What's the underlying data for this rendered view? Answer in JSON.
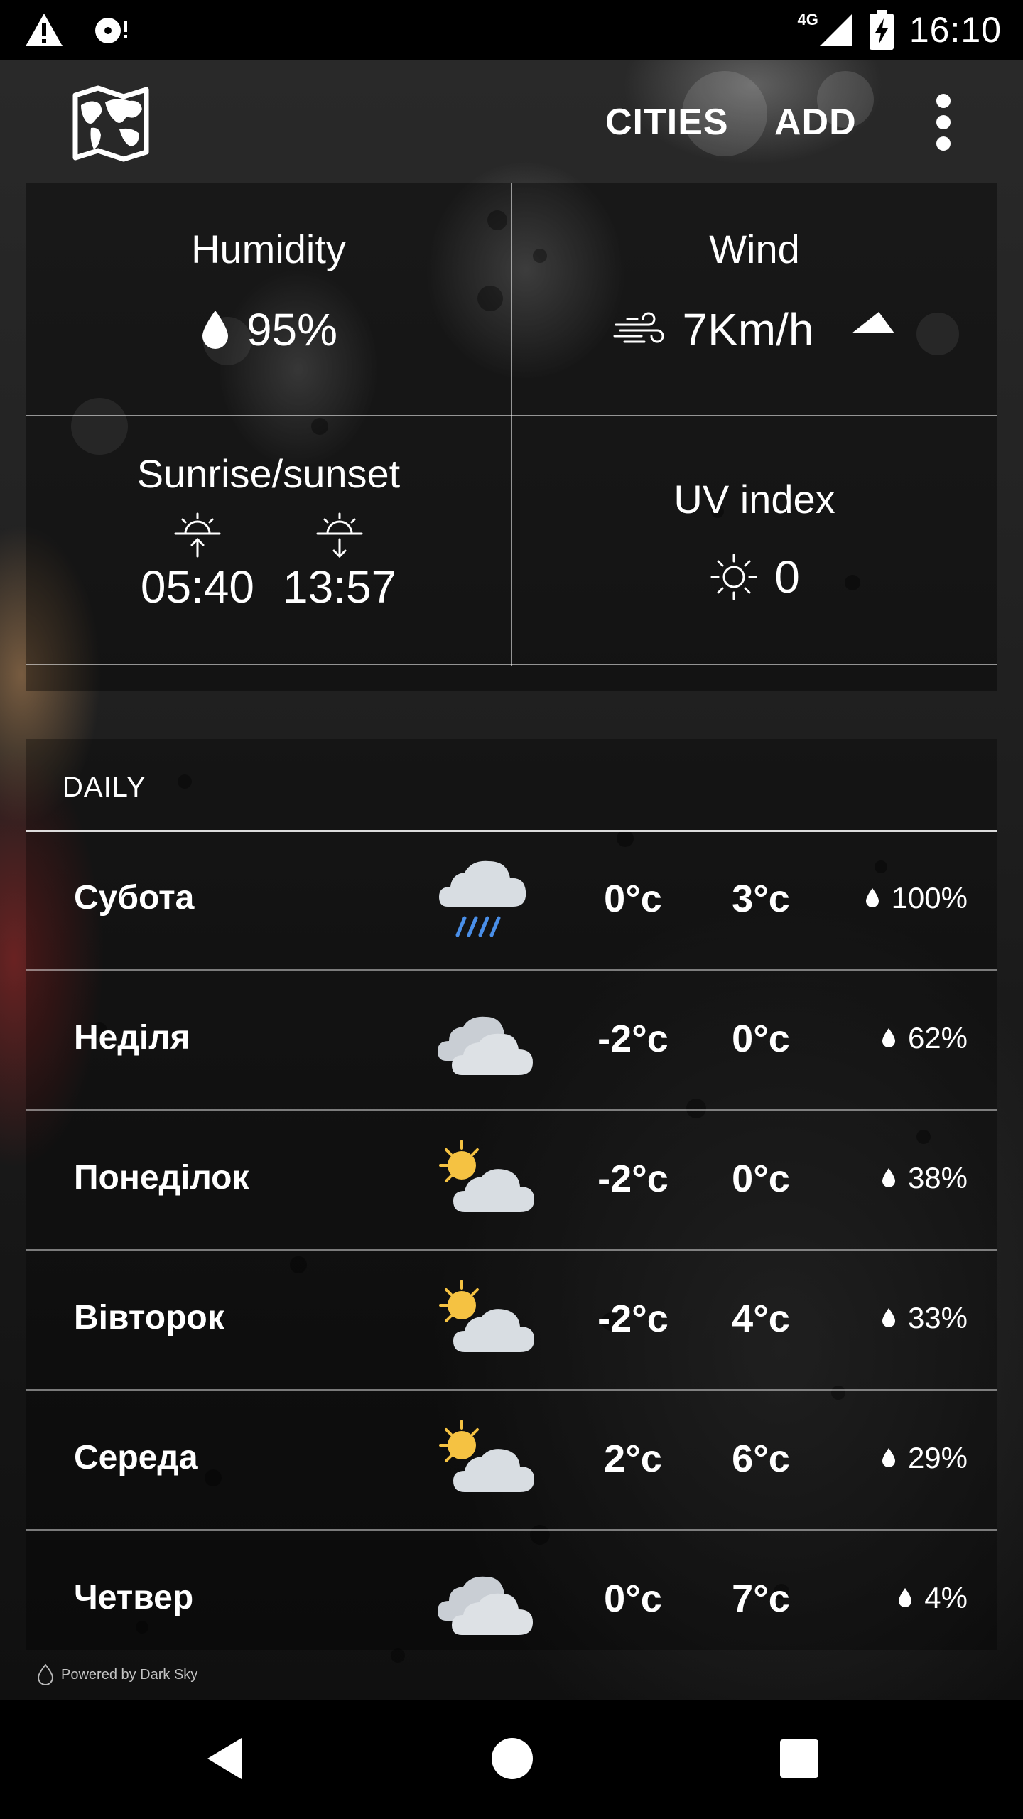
{
  "status_bar": {
    "time": "16:10",
    "network": "4G",
    "icons": [
      "warning-icon",
      "sd-card-icon",
      "signal-icon",
      "battery-charging-icon"
    ]
  },
  "app_bar": {
    "logo_icon": "world-map-icon",
    "cities_label": "CITIES",
    "add_label": "ADD",
    "menu_icon": "more-vert-icon"
  },
  "details": {
    "humidity": {
      "title": "Humidity",
      "value": "95%",
      "icon": "water-drop-icon"
    },
    "wind": {
      "title": "Wind",
      "value": "7Km/h",
      "icon": "wind-icon",
      "direction_icon": "wind-direction-icon"
    },
    "sun": {
      "title": "Sunrise/sunset",
      "sunrise": "05:40",
      "sunset": "13:57"
    },
    "uv": {
      "title": "UV index",
      "value": "0",
      "icon": "sun-icon"
    }
  },
  "daily": {
    "header": "DAILY",
    "rows": [
      {
        "day": "Субота",
        "icon": "rain-cloud-icon",
        "min": "0°c",
        "max": "3°c",
        "precip": "100%"
      },
      {
        "day": "Неділя",
        "icon": "cloudy-icon",
        "min": "-2°c",
        "max": "0°c",
        "precip": "62%"
      },
      {
        "day": "Понеділок",
        "icon": "partly-cloudy-icon",
        "min": "-2°c",
        "max": "0°c",
        "precip": "38%"
      },
      {
        "day": "Вівторок",
        "icon": "partly-cloudy-icon",
        "min": "-2°c",
        "max": "4°c",
        "precip": "33%"
      },
      {
        "day": "Середа",
        "icon": "partly-cloudy-icon",
        "min": "2°c",
        "max": "6°c",
        "precip": "29%"
      },
      {
        "day": "Четвер",
        "icon": "cloudy-icon",
        "min": "0°c",
        "max": "7°c",
        "precip": "4%"
      }
    ]
  },
  "footer": {
    "powered_by": "Powered by Dark Sky"
  },
  "colors": {
    "rain_streak": "#4a8fe8",
    "sun": "#f5c242",
    "cloud": "#d8dde2"
  }
}
